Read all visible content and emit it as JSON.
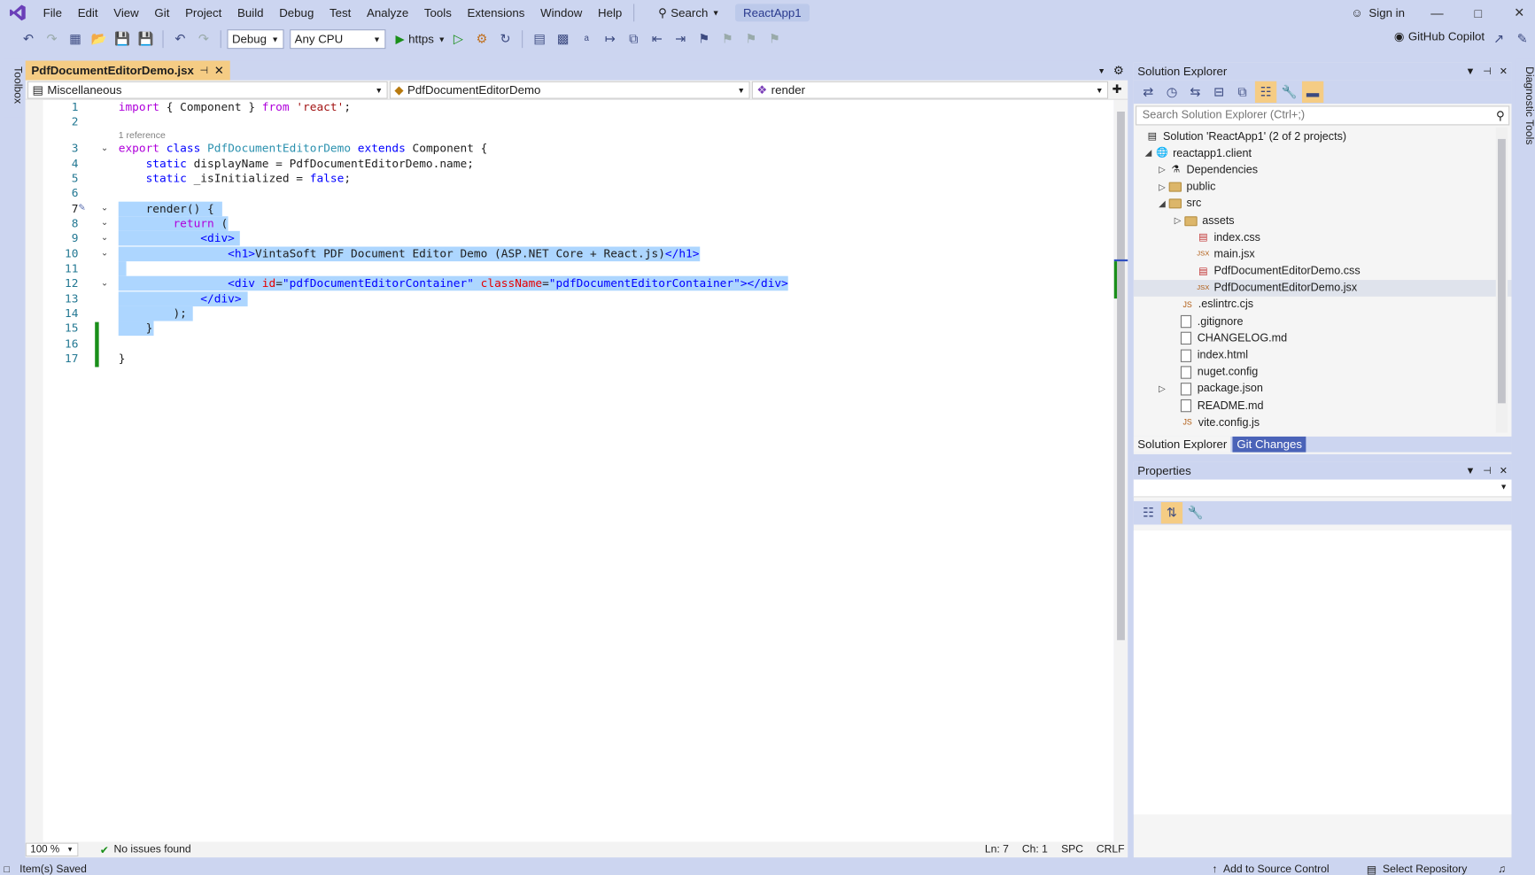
{
  "menubar": {
    "items": [
      "File",
      "Edit",
      "View",
      "Git",
      "Project",
      "Build",
      "Debug",
      "Test",
      "Analyze",
      "Tools",
      "Extensions",
      "Window",
      "Help"
    ],
    "search_label": "Search",
    "solution_name": "ReactApp1",
    "sign_in": "Sign in"
  },
  "toolbar": {
    "config": "Debug",
    "platform": "Any CPU",
    "run_target": "https",
    "copilot": "GitHub Copilot"
  },
  "side": {
    "left_tab": "Toolbox",
    "right_tab": "Diagnostic Tools"
  },
  "editor": {
    "tab_name": "PdfDocumentEditorDemo.jsx",
    "nav_project": "Miscellaneous",
    "nav_type": "PdfDocumentEditorDemo",
    "nav_member": "render",
    "codelens": "1 reference",
    "line_numbers": [
      "1",
      "2",
      "3",
      "4",
      "5",
      "6",
      "7",
      "8",
      "9",
      "10",
      "11",
      "12",
      "13",
      "14",
      "15",
      "16",
      "17"
    ],
    "zoom": "100 %",
    "issues": "No issues found",
    "ln": "Ln: 7",
    "ch": "Ch: 1",
    "spc": "SPC",
    "crlf": "CRLF"
  },
  "code": {
    "l1": {
      "a": "import",
      "b": " { Component } ",
      "c": "from",
      "d": " 'react'",
      "e": ";"
    },
    "l3": {
      "a": "export",
      "b": " class ",
      "c": "PdfDocumentEditorDemo",
      "d": " extends ",
      "e": "Component {"
    },
    "l4": {
      "a": "    static ",
      "b": "displayName = ",
      "c": "PdfDocumentEditorDemo",
      "d": ".name;"
    },
    "l5": {
      "a": "    static ",
      "b": "_isInitialized = ",
      "c": "false",
      "d": ";"
    },
    "l7": {
      "a": "    render() {"
    },
    "l8": {
      "a": "        return",
      "b": " ("
    },
    "l9": {
      "a": "            <div>"
    },
    "l10": {
      "a": "                <h1>",
      "b": "VintaSoft PDF Document Editor Demo (ASP.NET Core + React.js)",
      "c": "</h1>"
    },
    "l12": {
      "a": "                <div ",
      "b": "id",
      "c": "=",
      "d": "\"pdfDocumentEditorContainer\"",
      "e": " className",
      "f": "=",
      "g": "\"pdfDocumentEditorContainer\"",
      "h": "></div>"
    },
    "l13": {
      "a": "            </div>"
    },
    "l14": {
      "a": "        );"
    },
    "l15": {
      "a": "    }"
    },
    "l17": {
      "a": "}"
    }
  },
  "solution_explorer": {
    "title": "Solution Explorer",
    "search_placeholder": "Search Solution Explorer (Ctrl+;)",
    "items": [
      {
        "label": "Solution 'ReactApp1' (2 of 2 projects)"
      },
      {
        "label": "reactapp1.client"
      },
      {
        "label": "Dependencies"
      },
      {
        "label": "public"
      },
      {
        "label": "src"
      },
      {
        "label": "assets"
      },
      {
        "label": "index.css"
      },
      {
        "label": "main.jsx"
      },
      {
        "label": "PdfDocumentEditorDemo.css"
      },
      {
        "label": "PdfDocumentEditorDemo.jsx"
      },
      {
        "label": ".eslintrc.cjs"
      },
      {
        "label": ".gitignore"
      },
      {
        "label": "CHANGELOG.md"
      },
      {
        "label": "index.html"
      },
      {
        "label": "nuget.config"
      },
      {
        "label": "package.json"
      },
      {
        "label": "README.md"
      },
      {
        "label": "vite.config.js"
      }
    ],
    "tab_active": "Solution Explorer",
    "tab_other": "Git Changes"
  },
  "properties": {
    "title": "Properties"
  },
  "status": {
    "saved": "Item(s) Saved",
    "source_control": "Add to Source Control",
    "repository": "Select Repository"
  }
}
